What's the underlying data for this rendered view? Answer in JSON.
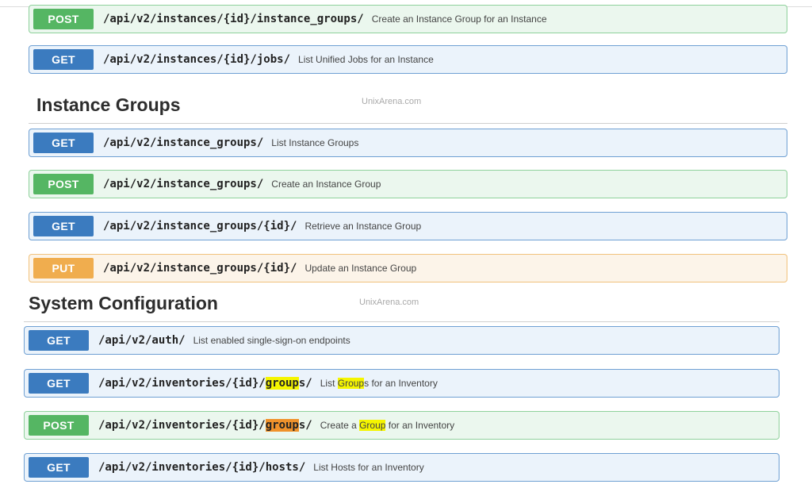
{
  "ops_top": [
    {
      "method": "POST",
      "path": "/api/v2/instances/{id}/instance_groups/",
      "desc": "Create an Instance Group for an Instance"
    },
    {
      "method": "GET",
      "path": "/api/v2/instances/{id}/jobs/",
      "desc": "List Unified Jobs for an Instance"
    }
  ],
  "section1": {
    "title": "Instance Groups",
    "watermark": "UnixArena.com",
    "ops": [
      {
        "method": "GET",
        "path": "/api/v2/instance_groups/",
        "desc": "List Instance Groups"
      },
      {
        "method": "POST",
        "path": "/api/v2/instance_groups/",
        "desc": "Create an Instance Group"
      },
      {
        "method": "GET",
        "path": "/api/v2/instance_groups/{id}/",
        "desc": "Retrieve an Instance Group"
      },
      {
        "method": "PUT",
        "path": "/api/v2/instance_groups/{id}/",
        "desc": "Update an Instance Group"
      }
    ]
  },
  "section2": {
    "title": "System Configuration",
    "watermark": "UnixArena.com",
    "ops": [
      {
        "method": "GET",
        "path": "/api/v2/auth/",
        "desc": "List enabled single-sign-on endpoints"
      },
      {
        "method": "GET",
        "path_pre": "/api/v2/inventories/{id}/",
        "path_hl": "group",
        "path_post": "s/",
        "desc_pre": "List ",
        "desc_hl": "Group",
        "desc_post": "s for an Inventory"
      },
      {
        "method": "POST",
        "path_pre": "/api/v2/inventories/{id}/",
        "path_hl": "group",
        "path_post": "s/",
        "desc_pre": "Create a ",
        "desc_hl": "Group",
        "desc_post": " for an Inventory"
      },
      {
        "method": "GET",
        "path": "/api/v2/inventories/{id}/hosts/",
        "desc": "List Hosts for an Inventory"
      }
    ]
  },
  "colors": {
    "get": "#3b7bbf",
    "post": "#55b663",
    "put": "#f0ad4e",
    "highlight_yellow": "#f5f500",
    "highlight_orange": "#f0922b"
  }
}
